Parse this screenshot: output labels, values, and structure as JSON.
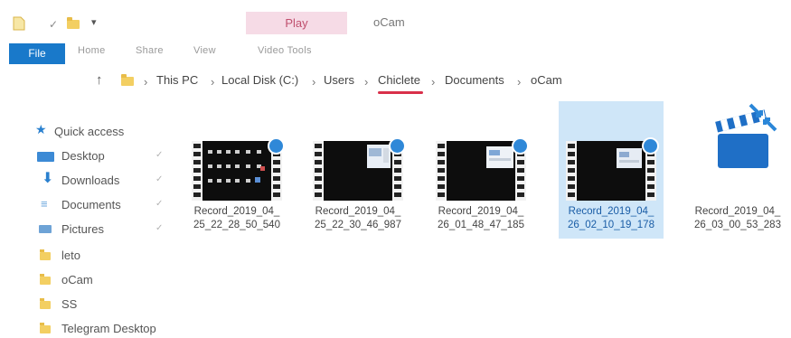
{
  "quick_access_toolbar": {
    "icons": [
      "file-icon",
      "checkmark-icon",
      "folder-icon",
      "dropdown-icon"
    ]
  },
  "contextual_tab": "Play",
  "window_title": "oCam",
  "ribbon": {
    "file_tab": "File",
    "tabs": [
      "Home",
      "Share",
      "View",
      "Video Tools"
    ]
  },
  "address_bar": {
    "breadcrumb": [
      "This PC",
      "Local Disk (C:)",
      "Users",
      "Chiclete",
      "Documents",
      "oCam"
    ],
    "separator": "›",
    "highlighted_segment": "Chiclete"
  },
  "navigation": {
    "items": [
      {
        "label": "Quick access",
        "icon": "star-icon"
      },
      {
        "label": "Desktop",
        "icon": "desktop-icon",
        "pinned": true
      },
      {
        "label": "Downloads",
        "icon": "download-icon",
        "pinned": true
      },
      {
        "label": "Documents",
        "icon": "documents-icon",
        "pinned": true
      },
      {
        "label": "Pictures",
        "icon": "pictures-icon",
        "pinned": true
      },
      {
        "label": "leto",
        "icon": "folder-icon"
      },
      {
        "label": "oCam",
        "icon": "folder-icon"
      },
      {
        "label": "SS",
        "icon": "folder-icon"
      },
      {
        "label": "Telegram Desktop",
        "icon": "folder-icon"
      }
    ],
    "pin_glyph": "✓"
  },
  "files": [
    {
      "name_line1": "Record_2019_04_",
      "name_line2": "25_22_28_50_540",
      "thumbnail": "video-thumbnail-grid"
    },
    {
      "name_line1": "Record_2019_04_",
      "name_line2": "25_22_30_46_987",
      "thumbnail": "video-thumbnail-window"
    },
    {
      "name_line1": "Record_2019_04_",
      "name_line2": "26_01_48_47_185",
      "thumbnail": "video-thumbnail-window"
    },
    {
      "name_line1": "Record_2019_04_",
      "name_line2": "26_02_10_19_178",
      "thumbnail": "video-thumbnail-window",
      "selected": true
    },
    {
      "name_line1": "Record_2019_04_",
      "name_line2": "26_03_00_53_283",
      "thumbnail": "clapperboard-icon"
    }
  ],
  "colors": {
    "accent": "#1979ca",
    "selection": "#cfe6f8",
    "contextual_tab_bg": "#f6dbe6",
    "underline": "#d9304a"
  }
}
